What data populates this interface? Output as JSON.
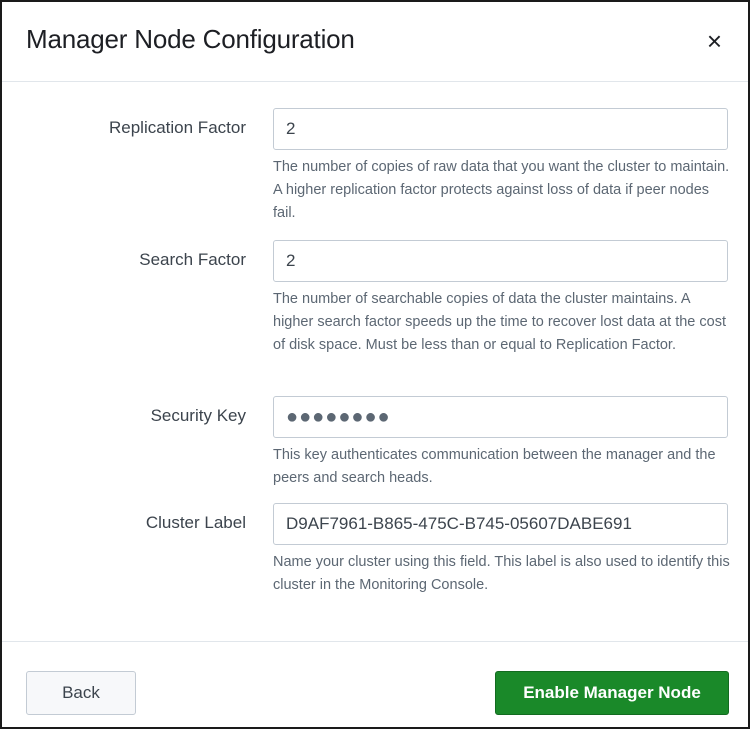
{
  "dialog": {
    "title": "Manager Node Configuration",
    "close_label": "×"
  },
  "fields": [
    {
      "label": "Replication Factor",
      "value": "2",
      "help": "The number of copies of raw data that you want the cluster to maintain. A higher replication factor protects against loss of data if peer nodes fail."
    },
    {
      "label": "Search Factor",
      "value": "2",
      "help": "The number of searchable copies of data the cluster maintains. A higher search factor speeds up the time to recover lost data at the cost of disk space. Must be less than or equal to Replication Factor."
    },
    {
      "label": "Security Key",
      "value": "●●●●●●●●",
      "help": "This key authenticates communication between the manager and the peers and search heads."
    },
    {
      "label": "Cluster Label",
      "value": "D9AF7961-B865-475C-B745-05607DABE691",
      "help": "Name your cluster using this field. This label is also used to identify this cluster in the Monitoring Console."
    }
  ],
  "footer": {
    "back_label": "Back",
    "enable_label": "Enable Manager Node"
  },
  "colors": {
    "primary": "#1a8929"
  }
}
